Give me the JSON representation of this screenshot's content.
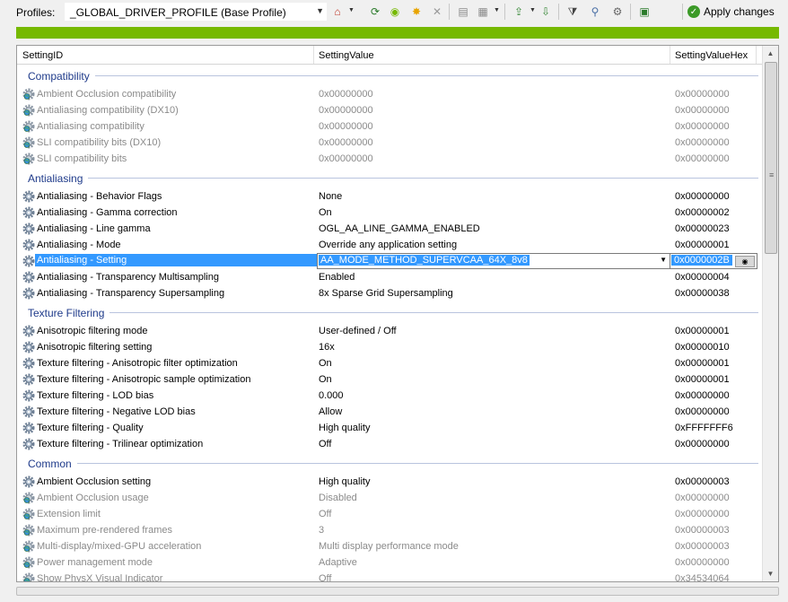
{
  "toolbar": {
    "profiles_label": "Profiles:",
    "profile_value": "_GLOBAL_DRIVER_PROFILE (Base Profile)",
    "apply_label": "Apply changes"
  },
  "columns": {
    "id": "SettingID",
    "value": "SettingValue",
    "hex": "SettingValueHex"
  },
  "groups": [
    {
      "title": "Compatibility",
      "rows": [
        {
          "id": "Ambient Occlusion compatibility",
          "value": "0x00000000",
          "hex": "0x00000000",
          "dim": true
        },
        {
          "id": "Antialiasing compatibility (DX10)",
          "value": "0x00000000",
          "hex": "0x00000000",
          "dim": true
        },
        {
          "id": "Antialiasing compatibility",
          "value": "0x00000000",
          "hex": "0x00000000",
          "dim": true
        },
        {
          "id": "SLI compatibility bits (DX10)",
          "value": "0x00000000",
          "hex": "0x00000000",
          "dim": true
        },
        {
          "id": "SLI compatibility bits",
          "value": "0x00000000",
          "hex": "0x00000000",
          "dim": true
        }
      ]
    },
    {
      "title": "Antialiasing",
      "rows": [
        {
          "id": "Antialiasing - Behavior Flags",
          "value": "None",
          "hex": "0x00000000"
        },
        {
          "id": "Antialiasing - Gamma correction",
          "value": "On",
          "hex": "0x00000002"
        },
        {
          "id": "Antialiasing - Line gamma",
          "value": "OGL_AA_LINE_GAMMA_ENABLED",
          "hex": "0x00000023"
        },
        {
          "id": "Antialiasing - Mode",
          "value": "Override any application setting",
          "hex": "0x00000001"
        },
        {
          "id": "Antialiasing - Setting",
          "value": "AA_MODE_METHOD_SUPERVCAA_64X_8v8",
          "hex": "0x0000002B",
          "selected": true
        },
        {
          "id": "Antialiasing - Transparency Multisampling",
          "value": "Enabled",
          "hex": "0x00000004"
        },
        {
          "id": "Antialiasing - Transparency Supersampling",
          "value": "8x Sparse Grid Supersampling",
          "hex": "0x00000038"
        }
      ]
    },
    {
      "title": "Texture Filtering",
      "rows": [
        {
          "id": "Anisotropic filtering mode",
          "value": "User-defined / Off",
          "hex": "0x00000001"
        },
        {
          "id": "Anisotropic filtering setting",
          "value": "16x",
          "hex": "0x00000010"
        },
        {
          "id": "Texture filtering - Anisotropic filter optimization",
          "value": "On",
          "hex": "0x00000001"
        },
        {
          "id": "Texture filtering - Anisotropic sample optimization",
          "value": "On",
          "hex": "0x00000001"
        },
        {
          "id": "Texture filtering - LOD bias",
          "value": "0.000",
          "hex": "0x00000000"
        },
        {
          "id": "Texture filtering - Negative LOD bias",
          "value": "Allow",
          "hex": "0x00000000"
        },
        {
          "id": "Texture filtering - Quality",
          "value": "High quality",
          "hex": "0xFFFFFFF6"
        },
        {
          "id": "Texture filtering - Trilinear optimization",
          "value": "Off",
          "hex": "0x00000000"
        }
      ]
    },
    {
      "title": "Common",
      "rows": [
        {
          "id": "Ambient Occlusion setting",
          "value": "High quality",
          "hex": "0x00000003"
        },
        {
          "id": "Ambient Occlusion usage",
          "value": "Disabled",
          "hex": "0x00000000",
          "dim": true
        },
        {
          "id": "Extension limit",
          "value": "Off",
          "hex": "0x00000000",
          "dim": true
        },
        {
          "id": "Maximum pre-rendered frames",
          "value": "3",
          "hex": "0x00000003",
          "dim": true
        },
        {
          "id": "Multi-display/mixed-GPU acceleration",
          "value": "Multi display performance mode",
          "hex": "0x00000003",
          "dim": true
        },
        {
          "id": "Power management mode",
          "value": "Adaptive",
          "hex": "0x00000000",
          "dim": true
        },
        {
          "id": "Show PhysX Visual Indicator",
          "value": "Off",
          "hex": "0x34534064",
          "dim": true
        }
      ]
    }
  ]
}
